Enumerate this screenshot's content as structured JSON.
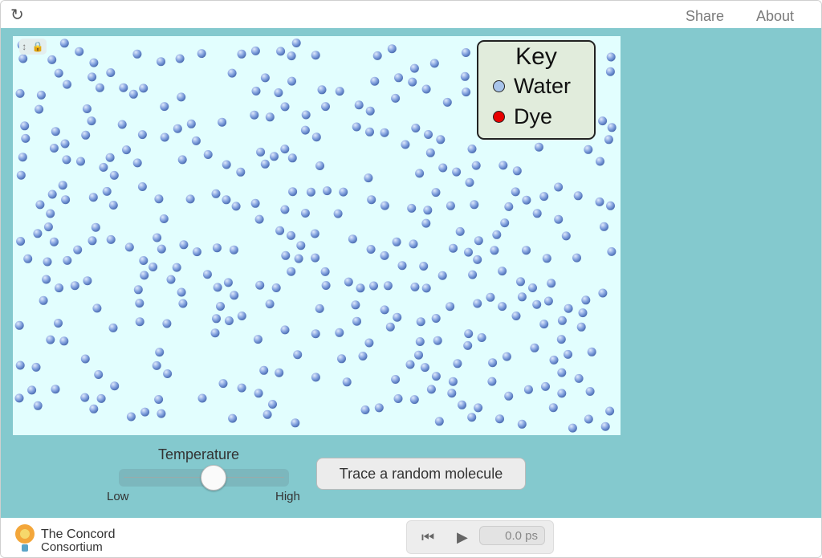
{
  "header": {
    "reload_icon": "reload-icon",
    "share_label": "Share",
    "about_label": "About"
  },
  "simulation": {
    "lock_icons": "toolbar-icons",
    "molecule_color": "#7f9fdd",
    "key": {
      "title": "Key",
      "items": [
        {
          "label": "Water",
          "color": "#a8c4ea"
        },
        {
          "label": "Dye",
          "color": "#e80000"
        }
      ]
    }
  },
  "controls": {
    "temperature_label": "Temperature",
    "temperature_value": 0.55,
    "low_label": "Low",
    "high_label": "High",
    "trace_button_label": "Trace a random molecule"
  },
  "footer": {
    "logo_line1": "The Concord",
    "logo_line2": "Consortium",
    "time_display": "0.0 ps"
  }
}
